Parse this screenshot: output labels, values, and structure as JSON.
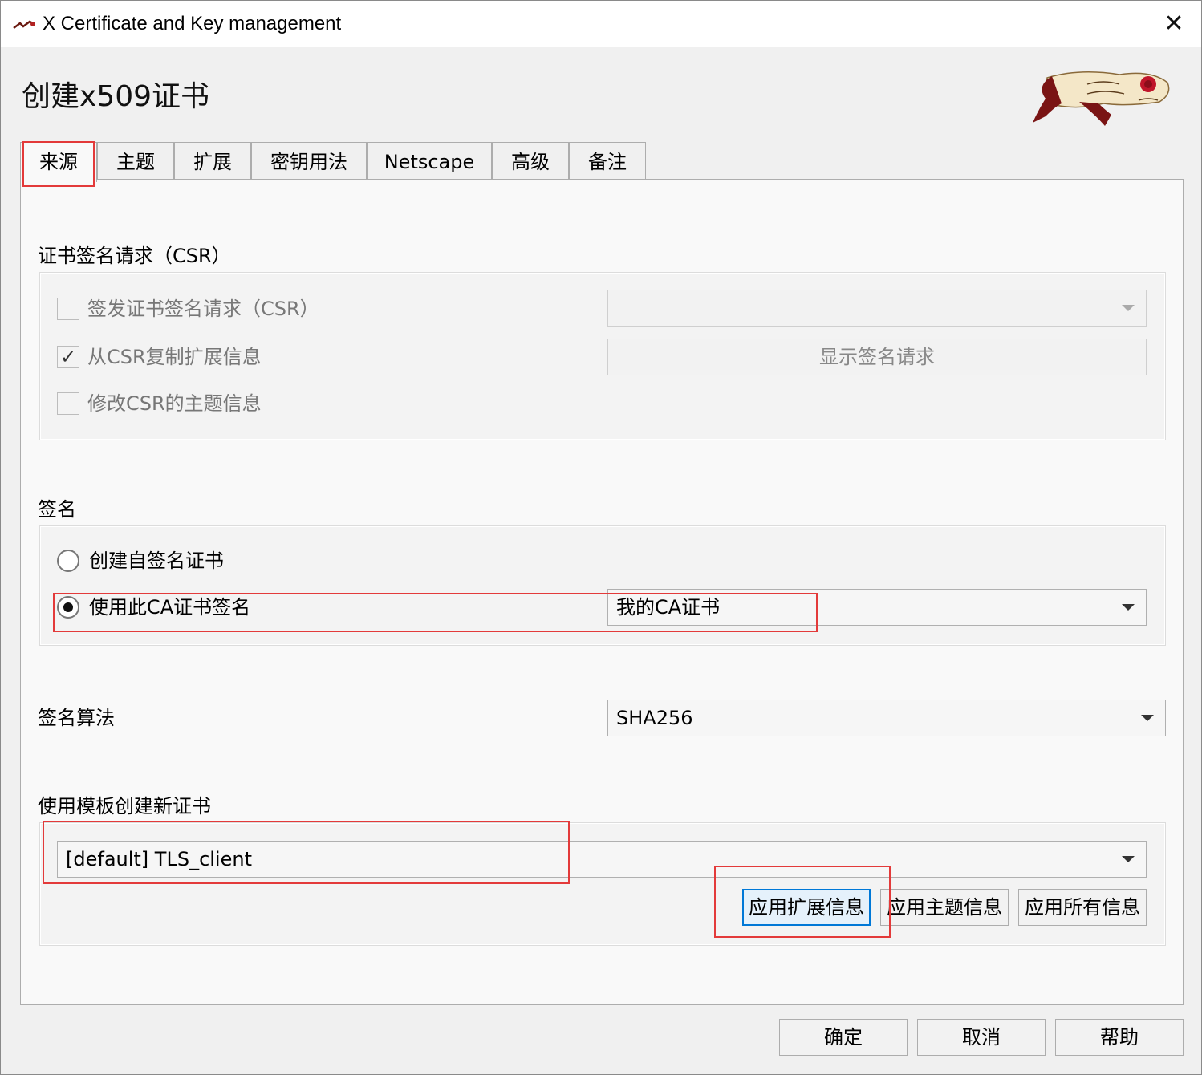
{
  "window": {
    "title": "X Certificate and Key management",
    "heading": "创建x509证书",
    "close_glyph": "✕"
  },
  "tabs": [
    {
      "label": "来源",
      "active": true
    },
    {
      "label": "主题",
      "active": false
    },
    {
      "label": "扩展",
      "active": false
    },
    {
      "label": "密钥用法",
      "active": false
    },
    {
      "label": "Netscape",
      "active": false
    },
    {
      "label": "高级",
      "active": false
    },
    {
      "label": "备注",
      "active": false
    }
  ],
  "csr": {
    "section_label": "证书签名请求（CSR）",
    "sign_request": {
      "label": "签发证书签名请求（CSR）",
      "checked": false
    },
    "copy_extensions": {
      "label": "从CSR复制扩展信息",
      "checked": true,
      "check_glyph": "✓"
    },
    "modify_subject": {
      "label": "修改CSR的主题信息",
      "checked": false
    },
    "request_select_value": "",
    "show_request_button": "显示签名请求"
  },
  "signing": {
    "section_label": "签名",
    "self_signed": {
      "label": "创建自签名证书",
      "selected": false
    },
    "use_ca": {
      "label": "使用此CA证书签名",
      "selected": true
    },
    "ca_select_value": "我的CA证书"
  },
  "algorithm": {
    "label": "签名算法",
    "value": "SHA256"
  },
  "template": {
    "section_label": "使用模板创建新证书",
    "select_value": "[default] TLS_client",
    "apply_extensions": "应用扩展信息",
    "apply_subject": "应用主题信息",
    "apply_all": "应用所有信息"
  },
  "footer": {
    "ok": "确定",
    "cancel": "取消",
    "help": "帮助"
  },
  "colors": {
    "highlight": "#e33a3a",
    "focus": "#0078d7"
  }
}
